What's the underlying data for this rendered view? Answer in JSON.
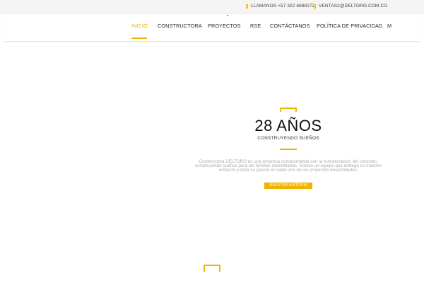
{
  "topbar": {
    "phone": "LLAMANOS +57 322 6888272",
    "email": "VENTAS2@DELTORO.COM.CO",
    "phone_icon": "phone-icon",
    "email_icon": "mail-icon"
  },
  "nav": {
    "items": [
      {
        "label": "INICIO"
      },
      {
        "label": "CONSTRUCTORA"
      },
      {
        "label": "PROYECTOS"
      },
      {
        "label": "RSE"
      },
      {
        "label": "CONTÁCTANOS"
      },
      {
        "label": "POLÍTICA DE PRIVACIDAD"
      },
      {
        "label": "M"
      }
    ]
  },
  "hero": {
    "title": "28 AÑOS",
    "subtitle": "CONSTRUYENDO SUEÑOS",
    "description": "Constructora DELTORO es una empresa comprometida con la humanización del concreto, construyendo sueños para las familias colombianas. Somos un equipo que entrega su máximo esfuerzo y toda su pasión en cada uno de los proyectos desarrollados.",
    "button": "NUESTRA HISTORIA"
  },
  "colors": {
    "accent": "#f0b400"
  }
}
